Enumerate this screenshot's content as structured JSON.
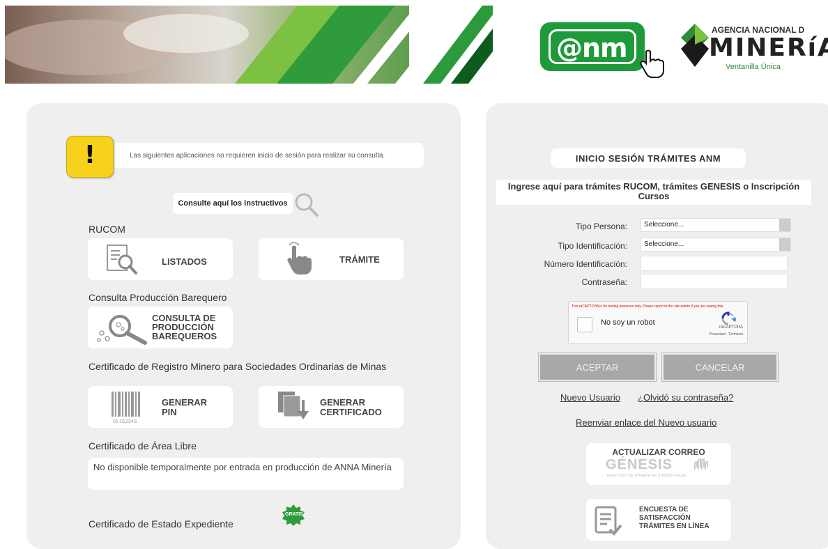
{
  "header": {
    "anm_logo_text": "@nm",
    "agency_line1": "AGENCIA NACIONAL D",
    "agency_line2": "MINERíA",
    "agency_line3": "Ventanilla Única",
    "brand_green": "#1f9a3a"
  },
  "left": {
    "notice": "Las siguientes aplicaciones no requieren inicio de sesión para realizar su consulta.",
    "instructivos": "Consulte aquí los instructivos",
    "sections": {
      "rucom": "RUCOM",
      "barequero": "Consulta Producción Barequero",
      "certificado_registro": "Certificado de Registro Minero para Sociedades Ordinarias de Minas",
      "area_libre": "Certificado de Área Libre",
      "estado_expediente": "Certificado de Estado Expediente"
    },
    "buttons": {
      "listados": "LISTADOS",
      "tramite": "TRÁMITE",
      "consulta_l1": "CONSULTA DE",
      "consulta_l2": "PRODUCCIÓN",
      "consulta_l3": "BAREQUEROS",
      "generar_pin_l1": "GENERAR",
      "generar_pin_l2": "PIN",
      "generar_cert_l1": "GENERAR",
      "generar_cert_l2": "CERTIFICADO",
      "barcode_number": "01-01234S"
    },
    "area_libre_msg": "No disponible temporalmente por entrada en producción de ANNA Minería",
    "gratis_badge": "GRATIS"
  },
  "right": {
    "title": "INICIO SESIÓN TRÁMITES ANM",
    "subtitle": "Ingrese aquí para trámites RUCOM, trámites GENESIS o Inscripción Cursos",
    "form": {
      "tipo_persona_label": "Tipo Persona:",
      "tipo_persona_value": "Seleccione...",
      "tipo_id_label": "Tipo Identificación:",
      "tipo_id_value": "Seleccione...",
      "numero_id_label": "Número Identificación:",
      "password_label": "Contraseña:"
    },
    "captcha": {
      "warning": "This reCAPTCHA is for testing purposes only. Please report to the site admin if you are seeing this.",
      "label": "No soy un robot",
      "brand": "reCAPTCHA",
      "links": "Privacidad - Términos"
    },
    "buttons": {
      "aceptar": "ACEPTAR",
      "cancelar": "CANCELAR"
    },
    "links": {
      "nuevo_usuario": "Nuevo Usuario",
      "olvido": "¿Olvidó su contraseña?",
      "reenviar": "Reenviar enlace del Nuevo usuario"
    },
    "genesis_card": {
      "title": "ACTUALIZAR CORREO",
      "logo": "GÉNESIS",
      "tagline": "REGISTRO DE MINERÍA DE SUBSISTENCIA"
    },
    "encuesta_card": {
      "l1": "ENCUESTA DE",
      "l2": "SATISFACCIÓN",
      "l3": "TRÁMITES EN LÍNEA"
    }
  }
}
